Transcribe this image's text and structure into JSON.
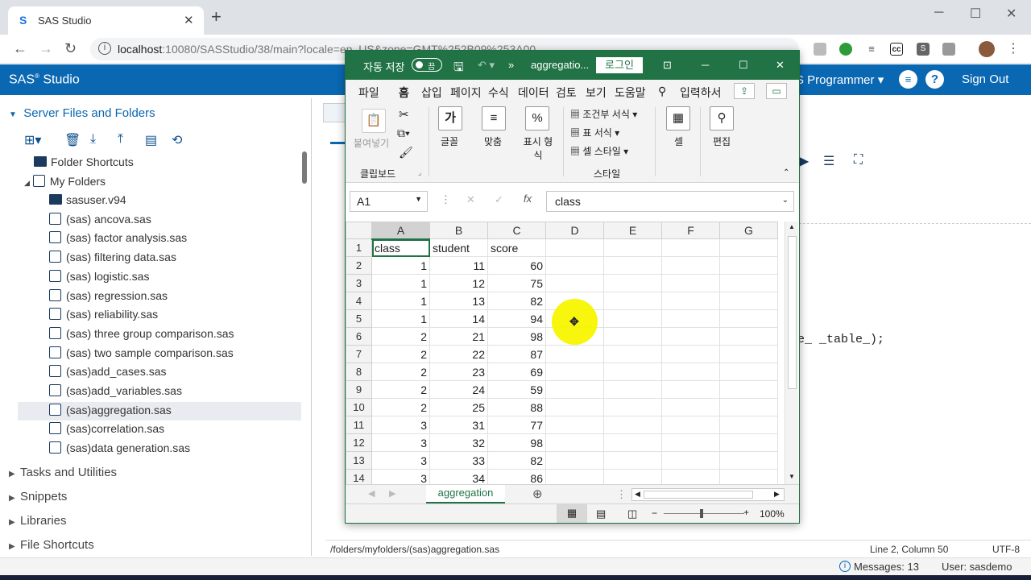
{
  "browser": {
    "tab_title": "SAS Studio",
    "url_host": "localhost",
    "url_rest": ":10080/SASStudio/38/main?locale=en_US&zone=GMT%252B09%253A00"
  },
  "sas": {
    "brand": "SAS",
    "brand_suffix": "Studio",
    "programmer": "S Programmer",
    "sign_out": "Sign Out",
    "server_files": "Server Files and Folders",
    "folder_shortcuts": "Folder Shortcuts",
    "my_folders": "My Folders",
    "tree_items": [
      "sasuser.v94",
      "(sas) ancova.sas",
      "(sas) factor analysis.sas",
      "(sas) filtering data.sas",
      "(sas) logistic.sas",
      "(sas) regression.sas",
      "(sas) reliability.sas",
      "(sas) three group comparison.sas",
      "(sas) two sample comparison.sas",
      "(sas)add_cases.sas",
      "(sas)add_variables.sas",
      "(sas)aggregation.sas",
      "(sas)correlation.sas",
      "(sas)data generation.sas"
    ],
    "sections": [
      "Tasks and Utilities",
      "Snippets",
      "Libraries",
      "File Shortcuts"
    ],
    "code_fragment": "e_ _table_);",
    "file_path": "/folders/myfolders/(sas)aggregation.sas",
    "line_col": "Line 2, Column 50",
    "encoding": "UTF-8",
    "messages": "Messages: 13",
    "user": "User: sasdemo"
  },
  "excel": {
    "autosave": "자동 저장",
    "toggle": "끔",
    "filename": "aggregatio...",
    "login": "로그인",
    "menu": [
      "파일",
      "홈",
      "삽입",
      "페이지",
      "수식",
      "데이터",
      "검토",
      "보기",
      "도움말",
      "입력하서"
    ],
    "paste": "붙여넣기",
    "font": "글꼴",
    "align": "맞춤",
    "number": "표시 형식",
    "cond": "조건부 서식",
    "table": "표 서식",
    "cellstyle": "셀 스타일",
    "cells": "셀",
    "edit": "편집",
    "clipboard": "클립보드",
    "style": "스타일",
    "namebox": "A1",
    "formula": "class",
    "columns": [
      "A",
      "B",
      "C",
      "D",
      "E",
      "F",
      "G"
    ],
    "headers": [
      "class",
      "student",
      "score"
    ],
    "rows": [
      [
        1,
        11,
        60
      ],
      [
        1,
        12,
        75
      ],
      [
        1,
        13,
        82
      ],
      [
        1,
        14,
        94
      ],
      [
        2,
        21,
        98
      ],
      [
        2,
        22,
        87
      ],
      [
        2,
        23,
        69
      ],
      [
        2,
        24,
        59
      ],
      [
        2,
        25,
        88
      ],
      [
        3,
        31,
        77
      ],
      [
        3,
        32,
        98
      ],
      [
        3,
        33,
        82
      ],
      [
        3,
        34,
        86
      ]
    ],
    "sheet": "aggregation",
    "zoom": "100%"
  }
}
